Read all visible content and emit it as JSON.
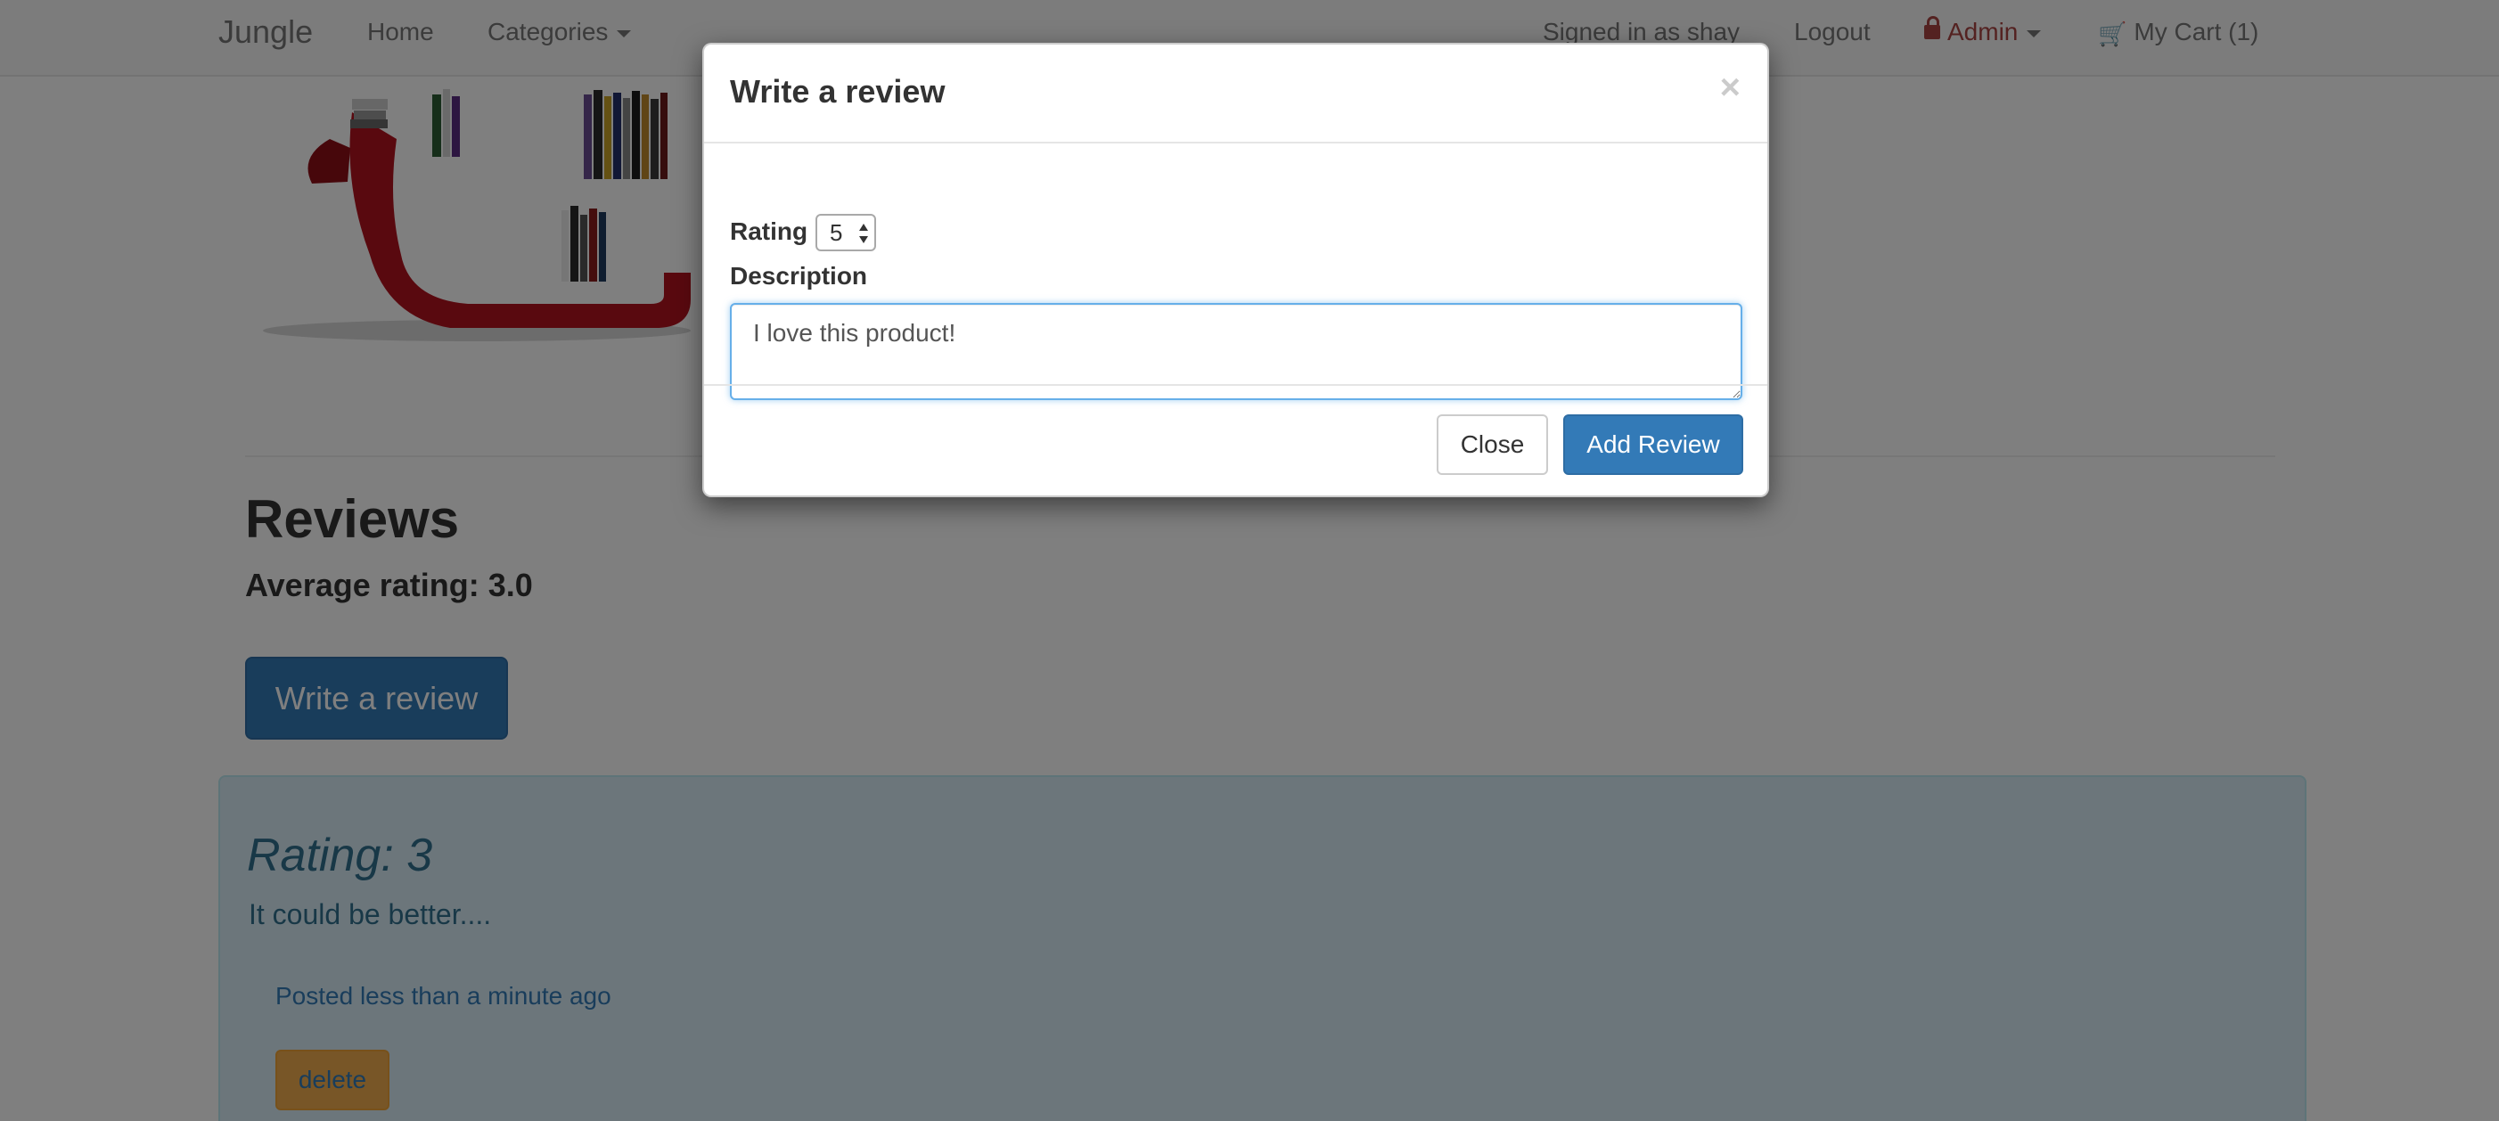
{
  "navbar": {
    "brand": "Jungle",
    "home": "Home",
    "categories": "Categories",
    "signed_in": "Signed in as shay",
    "logout": "Logout",
    "admin": "Admin",
    "cart": "My Cart (1)"
  },
  "product": {
    "image_alt": "Red bookshelf chair with books"
  },
  "reviews": {
    "title": "Reviews",
    "average": "Average rating: 3.0",
    "write_button": "Write a review",
    "items": [
      {
        "rating": "Rating: 3",
        "text": "It could be better....",
        "posted": "Posted less than a minute ago",
        "delete": "delete"
      }
    ]
  },
  "modal": {
    "title": "Write a review",
    "close_x": "×",
    "rating_label": "Rating",
    "rating_value": "5",
    "description_label": "Description",
    "description_value": "I love this product!",
    "close_button": "Close",
    "add_button": "Add Review"
  },
  "colors": {
    "primary": "#337ab7",
    "warning": "#f0ad4e",
    "info_bg": "#d9edf7",
    "info_text": "#31708f",
    "admin": "#a94442"
  },
  "icons": {
    "lock": "lock-icon",
    "cart": "cart-icon",
    "close": "close-icon"
  }
}
